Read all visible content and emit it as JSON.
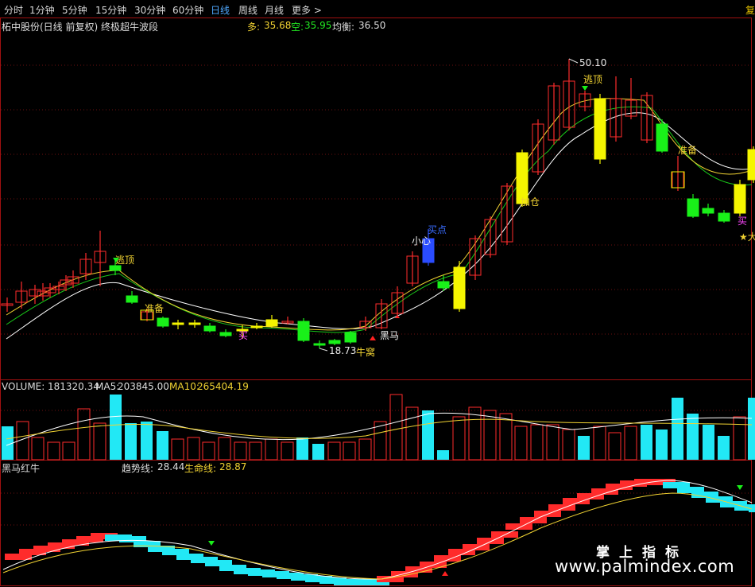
{
  "toolbar": {
    "tabs": [
      "分时",
      "1分钟",
      "5分钟",
      "15分钟",
      "30分钟",
      "60分钟",
      "日线",
      "周线",
      "月线",
      "更多 >"
    ],
    "active": "日线",
    "side_button": "复"
  },
  "main": {
    "title": "柘中股份(日线 前复权) 终极超牛波段",
    "duo_label": "多:",
    "duo_value": "35.68",
    "kong_label": "空:",
    "kong_value": "35.95",
    "junheng_label": "均衡:",
    "junheng_value": "36.50",
    "high_marker": "50.10",
    "low_marker": "18.73",
    "signals": {
      "taoding": "逃顶",
      "zhunbei": "准备",
      "mai": "买",
      "heima": "黑马",
      "niuwo": "牛窝",
      "jiacang": "加仓",
      "xiaoxin": "小心",
      "mairu": "买点",
      "taoding_top": "逃顶",
      "zhunbei2": "准备",
      "mai2": "买",
      "da": "★大"
    }
  },
  "volume": {
    "label": "VOLUME:",
    "value": "181320.34",
    "ma5_label": "MA5:",
    "ma5": "203845.00",
    "ma10_label": "MA10:",
    "ma10": "265404.19"
  },
  "indicator": {
    "name": "黑马红牛",
    "trend_label": "趋势线:",
    "trend": "28.44",
    "life_label": "生命线:",
    "life": "28.87"
  },
  "watermark": {
    "cn": "掌上指标",
    "url": "www.palmindex.com"
  },
  "colors": {
    "up": "#ff2b2b",
    "down": "#19f019",
    "yellow": "#f5f500",
    "cyan": "#22e8f5",
    "white": "#ffffff",
    "green_line": "#19c819",
    "gold": "#f0d232"
  }
}
